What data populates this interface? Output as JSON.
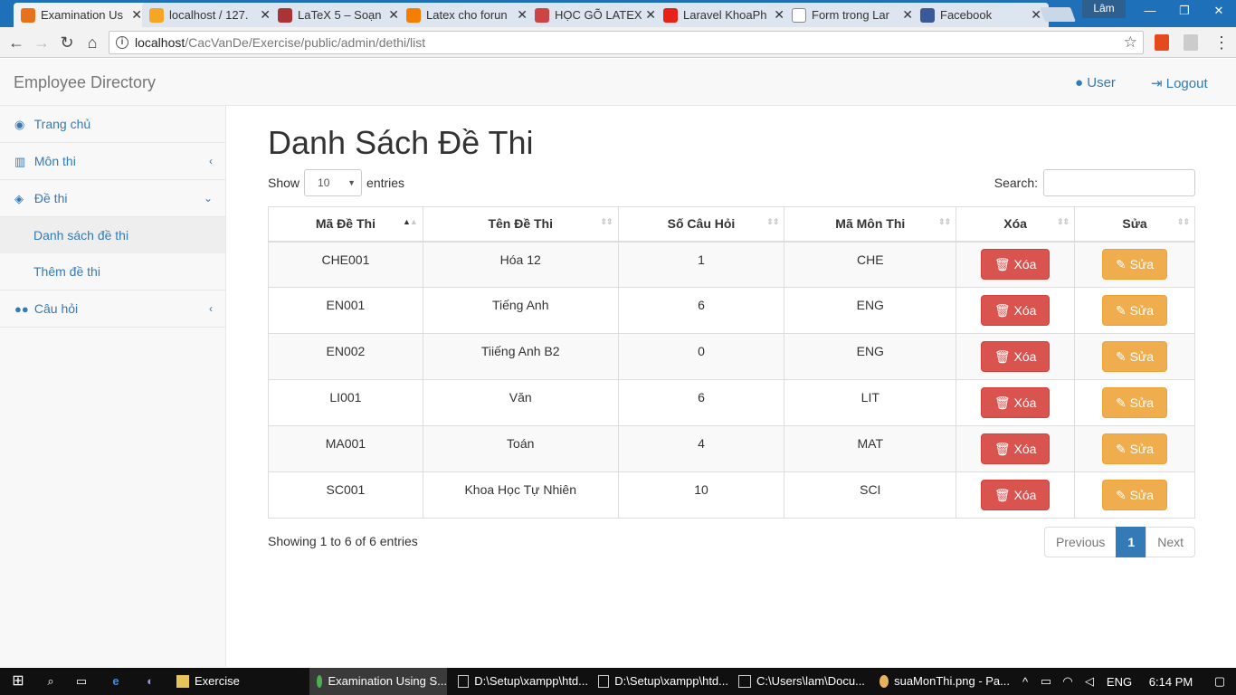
{
  "browser": {
    "tabs": [
      {
        "title": "Examination Us",
        "color": "#e8711c",
        "active": true
      },
      {
        "title": "localhost / 127.",
        "color": "#f6a623"
      },
      {
        "title": "LaTeX 5 – Soạn",
        "color": "#a33"
      },
      {
        "title": "Latex cho forun",
        "color": "#f57d00"
      },
      {
        "title": "HỌC GÕ LATEX",
        "color": "#c44"
      },
      {
        "title": "Laravel KhoaPh",
        "color": "#e62117"
      },
      {
        "title": "Form trong Lar",
        "color": "#888"
      },
      {
        "title": "Facebook",
        "color": "#3b5998"
      }
    ],
    "user_chip": "Lâm",
    "url_host": "localhost",
    "url_path": "/CacVanDe/Exercise/public/admin/dethi/list"
  },
  "header": {
    "brand": "Employee Directory",
    "user_label": "User",
    "logout_label": "Logout"
  },
  "sidebar": {
    "items": [
      {
        "label": "Trang chủ",
        "icon": "dashboard-icon"
      },
      {
        "label": "Môn thi",
        "icon": "bar-chart-icon"
      },
      {
        "label": "Đề thi",
        "icon": "cube-icon"
      },
      {
        "label": "Câu hỏi",
        "icon": "users-icon"
      }
    ],
    "sub_items": [
      {
        "label": "Danh sách đề thi"
      },
      {
        "label": "Thêm đề thi"
      }
    ]
  },
  "main": {
    "title": "Danh Sách Đề Thi",
    "show_label": "Show",
    "entries_value": "10",
    "entries_label": "entries",
    "search_label": "Search:",
    "columns": [
      "Mã Đề Thi",
      "Tên Đề Thi",
      "Số Câu Hỏi",
      "Mã Môn Thi",
      "Xóa",
      "Sửa"
    ],
    "rows": [
      {
        "code": "CHE001",
        "name": "Hóa 12",
        "count": "1",
        "subject": "CHE"
      },
      {
        "code": "EN001",
        "name": "Tiếng Anh",
        "count": "6",
        "subject": "ENG"
      },
      {
        "code": "EN002",
        "name": "Tiiếng Anh B2",
        "count": "0",
        "subject": "ENG"
      },
      {
        "code": "LI001",
        "name": "Văn",
        "count": "6",
        "subject": "LIT"
      },
      {
        "code": "MA001",
        "name": "Toán",
        "count": "4",
        "subject": "MAT"
      },
      {
        "code": "SC001",
        "name": "Khoa Học Tự Nhiên",
        "count": "10",
        "subject": "SCI"
      }
    ],
    "delete_label": "Xóa",
    "edit_label": "Sửa",
    "info": "Showing 1 to 6 of 6 entries",
    "pager": {
      "prev": "Previous",
      "page": "1",
      "next": "Next"
    }
  },
  "taskbar": {
    "items": [
      {
        "label": "Exercise"
      },
      {
        "label": "Examination Using S..."
      },
      {
        "label": "D:\\Setup\\xampp\\htd..."
      },
      {
        "label": "D:\\Setup\\xampp\\htd..."
      },
      {
        "label": "C:\\Users\\lam\\Docu..."
      },
      {
        "label": "suaMonThi.png - Pa..."
      }
    ],
    "lang": "ENG",
    "time": "6:14 PM"
  },
  "colors": {
    "primary": "#337ab7",
    "danger": "#d9534f",
    "warning": "#f0ad4e"
  }
}
